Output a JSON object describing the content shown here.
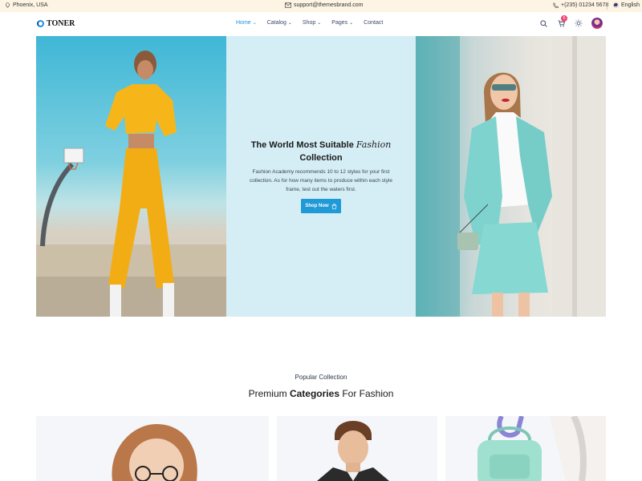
{
  "topbar": {
    "location": "Phoenix, USA",
    "email": "support@themesbrand.com",
    "phone": "+(235) 01234 5678",
    "language": "English"
  },
  "header": {
    "logo": "TONER",
    "nav": [
      {
        "label": "Home",
        "dropdown": true,
        "active": true
      },
      {
        "label": "Catalog",
        "dropdown": true
      },
      {
        "label": "Shop",
        "dropdown": true
      },
      {
        "label": "Pages",
        "dropdown": true
      },
      {
        "label": "Contact",
        "dropdown": false
      }
    ],
    "cart_count": "6",
    "icons": [
      "search-icon",
      "cart-icon",
      "sun-icon",
      "avatar"
    ]
  },
  "hero": {
    "title_part1": "The World Most Suitable",
    "title_script": "Fashion",
    "title_part2": "Collection",
    "description": "Fashion Academy recommends 10 to 12 styles for your first collection. As for how many items to produce within each style frame, test out the waters first.",
    "button": "Shop Now"
  },
  "collection": {
    "subtitle": "Popular Collection",
    "title_pre": "Premium",
    "title_bold": "Categories",
    "title_post": "For Fashion"
  },
  "colors": {
    "accent": "#1f9ad6",
    "topbar_bg": "#fdf4e3",
    "hero_center_bg": "#d5eef6",
    "badge": "#ef476f"
  }
}
